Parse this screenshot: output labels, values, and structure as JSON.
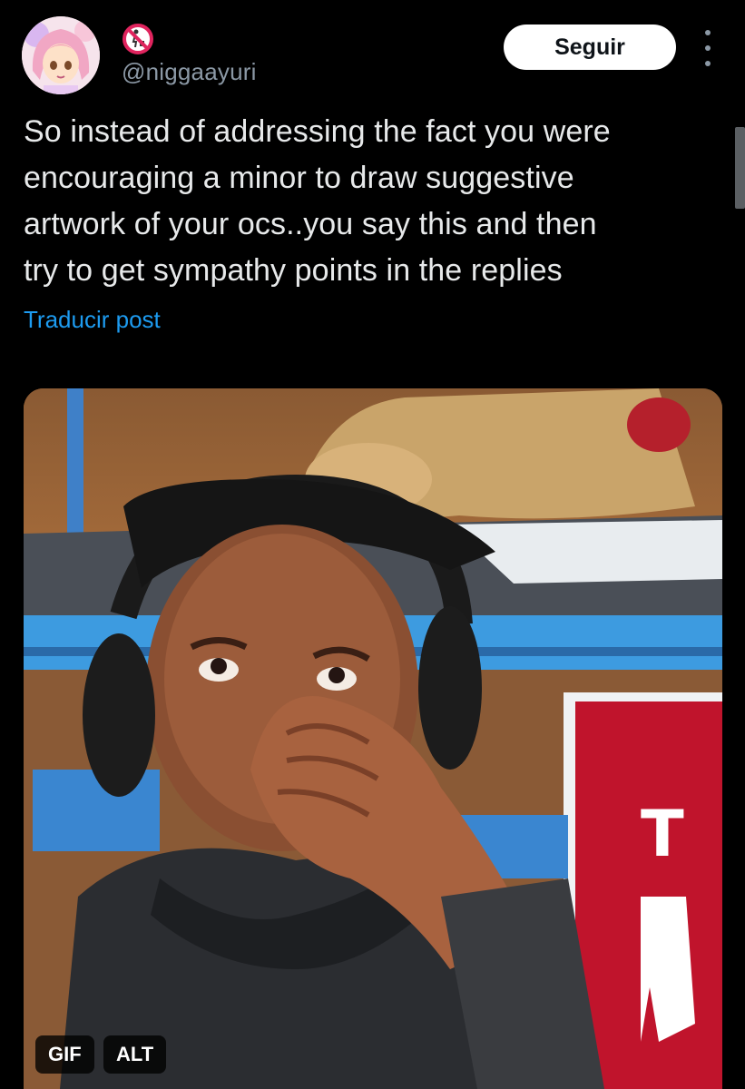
{
  "author": {
    "handle": "@niggaayuri",
    "avatar_icon": "anime-avatar",
    "badge_icon": "no-littering-emoji-icon"
  },
  "actions": {
    "follow_label": "Seguir",
    "more_icon": "more-vertical-icon"
  },
  "tweet": {
    "text": "So instead of addressing the fact you were\nencouraging a minor to draw suggestive\nartwork of your ocs..you say this and then\ntry to get sympathy points in the replies",
    "translate_label": "Traducir post"
  },
  "media": {
    "gif_badge": "GIF",
    "alt_badge": "ALT"
  },
  "colors": {
    "background": "#000000",
    "text": "#e7e9ea",
    "secondary_text": "#8b98a5",
    "link": "#1d9bf0",
    "button_bg": "#ffffff"
  }
}
